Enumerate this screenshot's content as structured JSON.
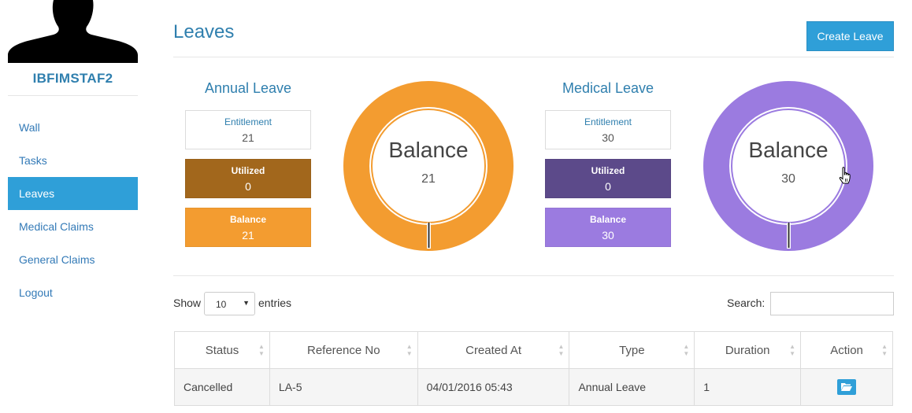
{
  "sidebar": {
    "username": "IBFIMSTAF2",
    "nav": [
      {
        "label": "Wall"
      },
      {
        "label": "Tasks"
      },
      {
        "label": "Leaves",
        "active": true
      },
      {
        "label": "Medical Claims"
      },
      {
        "label": "General Claims"
      },
      {
        "label": "Logout"
      }
    ]
  },
  "header": {
    "title": "Leaves",
    "create_button": "Create Leave"
  },
  "annual": {
    "title": "Annual Leave",
    "entitlement_label": "Entitlement",
    "entitlement_value": "21",
    "utilized_label": "Utilized",
    "utilized_value": "0",
    "balance_label": "Balance",
    "balance_value": "21",
    "donut_label": "Balance",
    "donut_value": "21",
    "color": "#f39c30",
    "utilized_color": "#a2671c"
  },
  "medical": {
    "title": "Medical Leave",
    "entitlement_label": "Entitlement",
    "entitlement_value": "30",
    "utilized_label": "Utilized",
    "utilized_value": "0",
    "balance_label": "Balance",
    "balance_value": "30",
    "donut_label": "Balance",
    "donut_value": "30",
    "color": "#9b7be0",
    "utilized_color": "#5c4a8a"
  },
  "table_controls": {
    "show_label": "Show",
    "entries_value": "10",
    "entries_label": "entries",
    "search_label": "Search:"
  },
  "table": {
    "headers": [
      "Status",
      "Reference No",
      "Created At",
      "Type",
      "Duration",
      "Action"
    ],
    "rows": [
      {
        "status": "Cancelled",
        "reference": "LA-5",
        "created_at": "04/01/2016 05:43",
        "type": "Annual Leave",
        "duration": "1",
        "action_icon": "folder-open-icon"
      }
    ]
  }
}
